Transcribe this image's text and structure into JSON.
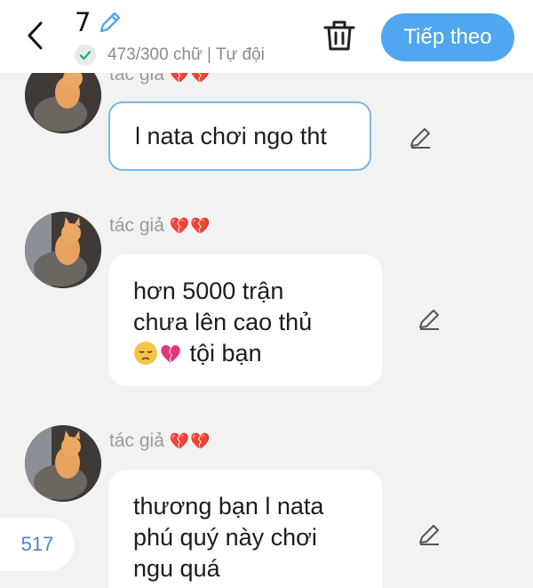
{
  "header": {
    "title": "7",
    "char_count": "473/300 chữ | Tự đội",
    "next_label": "Tiếp theo"
  },
  "messages": [
    {
      "author": "tác giả",
      "hearts": "💔💔",
      "text": "l nata chơi ngo tht",
      "selected": true
    },
    {
      "author": "tác giả",
      "hearts": "💔💔",
      "line1": "hơn 5000 trận",
      "line2": "chưa lên cao thủ",
      "line3": "tội bạn"
    },
    {
      "author": "tác giả",
      "hearts": "💔💔",
      "line1": "thương bạn l nata",
      "line2": "phú quý này chơi",
      "line3": "ngu quá"
    }
  ],
  "footer": {
    "count": "517"
  },
  "colors": {
    "accent": "#4fa7ef",
    "selected_border": "#7ab6ee",
    "background": "#f2f2f2"
  },
  "icons": [
    "back-icon",
    "pencil-icon",
    "check-icon",
    "trash-icon",
    "broken-heart-icon",
    "pensive-face-icon"
  ]
}
